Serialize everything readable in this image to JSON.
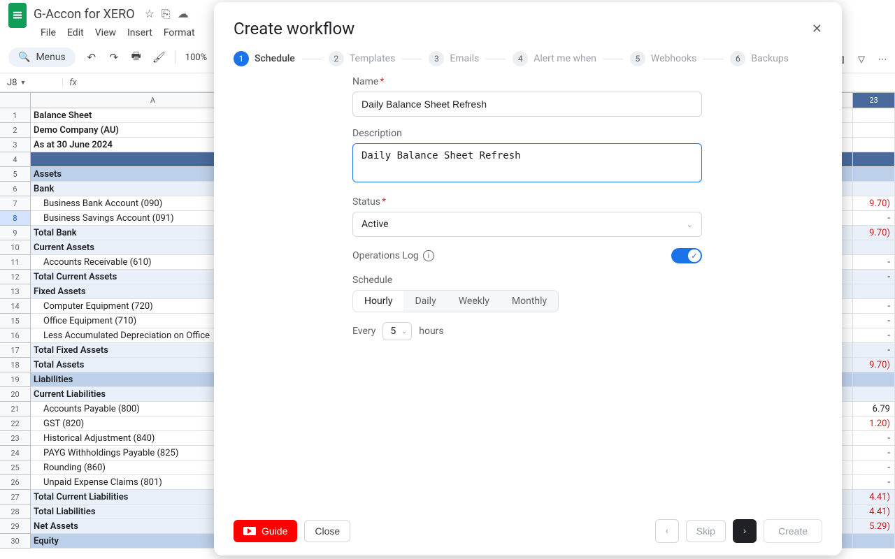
{
  "sheets_header": {
    "doc_title": "G-Accon for XERO",
    "menus": [
      "File",
      "Edit",
      "View",
      "Insert",
      "Format"
    ],
    "search_label": "Menus",
    "zoom": "100%",
    "cell_ref": "J8",
    "col_label_A": "A",
    "year_header": "23"
  },
  "sheet_rows": [
    {
      "n": "1",
      "a": "Balance Sheet",
      "cls": "bold",
      "last": "",
      "lcls": ""
    },
    {
      "n": "2",
      "a": "Demo Company (AU)",
      "cls": "bold",
      "last": "",
      "lcls": ""
    },
    {
      "n": "3",
      "a": "As at 30 June 2024",
      "cls": "bold",
      "last": "",
      "lcls": ""
    },
    {
      "n": "4",
      "a": "",
      "cls": "",
      "last": "",
      "lcls": "",
      "rowbg": "bg-dark"
    },
    {
      "n": "5",
      "a": "Assets",
      "cls": "bold",
      "last": "",
      "lcls": "",
      "rowbg": "bg-hdr"
    },
    {
      "n": "6",
      "a": "Bank",
      "cls": "bold",
      "last": "",
      "lcls": "",
      "rowbg": "bg-light"
    },
    {
      "n": "7",
      "a": "Business Bank Account (090)",
      "cls": "indent1",
      "last": "9.70)",
      "lcls": "neg"
    },
    {
      "n": "8",
      "a": "Business Savings Account (091)",
      "cls": "indent1",
      "last": "-",
      "lcls": "",
      "sel": true
    },
    {
      "n": "9",
      "a": "Total Bank",
      "cls": "bold",
      "last": "9.70)",
      "lcls": "neg",
      "rowbg": "bg-light"
    },
    {
      "n": "10",
      "a": "Current Assets",
      "cls": "bold",
      "last": "",
      "lcls": "",
      "rowbg": "bg-light"
    },
    {
      "n": "11",
      "a": "Accounts Receivable (610)",
      "cls": "indent1",
      "last": "-",
      "lcls": ""
    },
    {
      "n": "12",
      "a": "Total Current Assets",
      "cls": "bold",
      "last": "-",
      "lcls": "",
      "rowbg": "bg-light"
    },
    {
      "n": "13",
      "a": "Fixed Assets",
      "cls": "bold",
      "last": "",
      "lcls": "",
      "rowbg": "bg-light"
    },
    {
      "n": "14",
      "a": "Computer Equipment (720)",
      "cls": "indent1",
      "last": "-",
      "lcls": ""
    },
    {
      "n": "15",
      "a": "Office Equipment (710)",
      "cls": "indent1",
      "last": "-",
      "lcls": ""
    },
    {
      "n": "16",
      "a": "Less Accumulated Depreciation on Office",
      "cls": "indent1",
      "last": "-",
      "lcls": ""
    },
    {
      "n": "17",
      "a": "Total Fixed Assets",
      "cls": "bold",
      "last": "-",
      "lcls": "",
      "rowbg": "bg-light"
    },
    {
      "n": "18",
      "a": "Total Assets",
      "cls": "bold",
      "last": "9.70)",
      "lcls": "neg",
      "rowbg": "bg-light"
    },
    {
      "n": "19",
      "a": "Liabilities",
      "cls": "bold",
      "last": "",
      "lcls": "",
      "rowbg": "bg-hdr"
    },
    {
      "n": "20",
      "a": "Current Liabilities",
      "cls": "bold",
      "last": "",
      "lcls": "",
      "rowbg": "bg-light"
    },
    {
      "n": "21",
      "a": "Accounts Payable (800)",
      "cls": "indent1",
      "last": "6.79",
      "lcls": ""
    },
    {
      "n": "22",
      "a": "GST (820)",
      "cls": "indent1",
      "last": "1.20)",
      "lcls": "neg"
    },
    {
      "n": "23",
      "a": "Historical Adjustment (840)",
      "cls": "indent1",
      "last": "-",
      "lcls": ""
    },
    {
      "n": "24",
      "a": "PAYG Withholdings Payable (825)",
      "cls": "indent1",
      "last": "-",
      "lcls": ""
    },
    {
      "n": "25",
      "a": "Rounding (860)",
      "cls": "indent1",
      "last": "-",
      "lcls": ""
    },
    {
      "n": "26",
      "a": "Unpaid Expense Claims (801)",
      "cls": "indent1",
      "last": "-",
      "lcls": ""
    },
    {
      "n": "27",
      "a": "Total Current Liabilities",
      "cls": "bold",
      "last": "4.41)",
      "lcls": "neg",
      "rowbg": "bg-light"
    },
    {
      "n": "28",
      "a": "Total Liabilities",
      "cls": "bold",
      "last": "4.41)",
      "lcls": "neg",
      "rowbg": "bg-light"
    },
    {
      "n": "29",
      "a": "Net Assets",
      "cls": "bold",
      "last": "5.29)",
      "lcls": "neg",
      "rowbg": "bg-light"
    },
    {
      "n": "30",
      "a": "Equity",
      "cls": "bold",
      "last": "",
      "lcls": "",
      "rowbg": "bg-hdr"
    }
  ],
  "modal": {
    "title": "Create workflow",
    "steps": [
      {
        "num": "1",
        "label": "Schedule"
      },
      {
        "num": "2",
        "label": "Templates"
      },
      {
        "num": "3",
        "label": "Emails"
      },
      {
        "num": "4",
        "label": "Alert me when"
      },
      {
        "num": "5",
        "label": "Webhooks"
      },
      {
        "num": "6",
        "label": "Backups"
      }
    ],
    "name_label": "Name",
    "name_value": "Daily Balance Sheet Refresh",
    "desc_label": "Description",
    "desc_value": "Daily Balance Sheet Refresh",
    "status_label": "Status",
    "status_value": "Active",
    "ops_log_label": "Operations Log",
    "schedule_label": "Schedule",
    "seg": [
      "Hourly",
      "Daily",
      "Weekly",
      "Monthly"
    ],
    "every_label": "Every",
    "every_value": "5",
    "hours_label": "hours",
    "guide": "Guide",
    "close": "Close",
    "skip": "Skip",
    "create": "Create"
  }
}
